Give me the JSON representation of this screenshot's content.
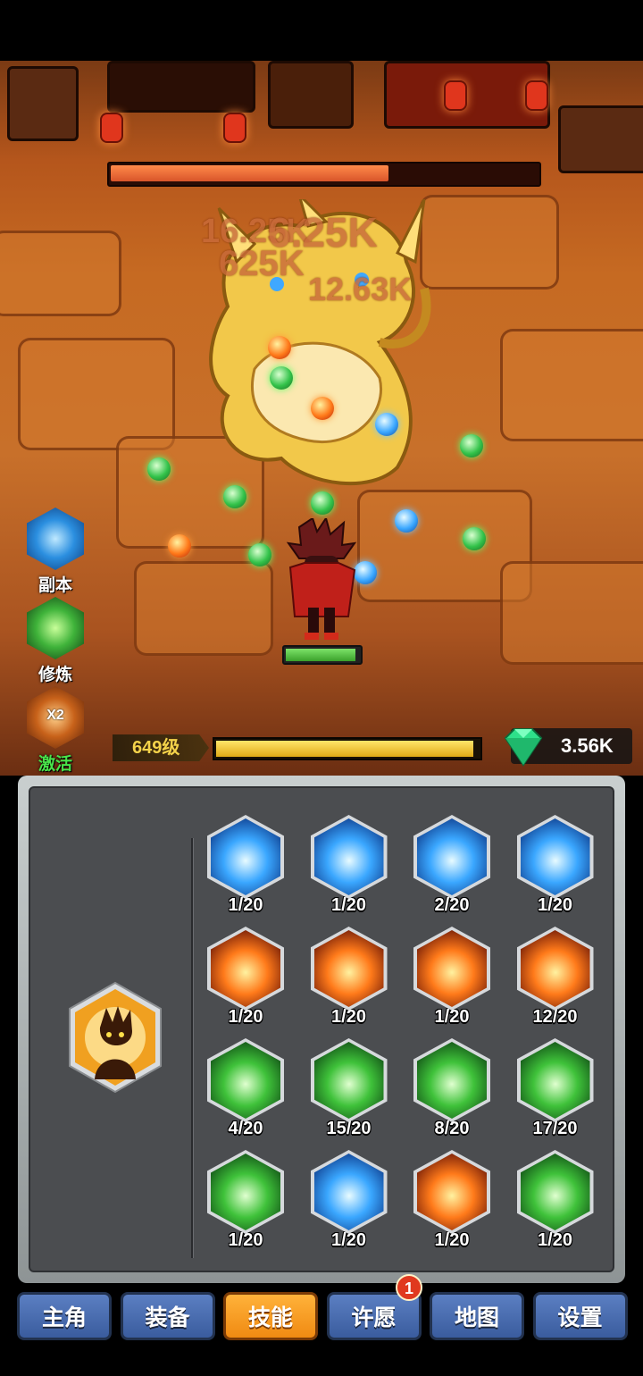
{
  "battle": {
    "damage_numbers": [
      "6.25K",
      "625K",
      "12.63K",
      "16.25K"
    ],
    "boss_hp_fraction": 0.65,
    "hero_hp_fraction": 0.95
  },
  "side_buttons": [
    {
      "label": "副本",
      "icon": "vortex-icon"
    },
    {
      "label": "修炼",
      "icon": "cultivation-icon"
    },
    {
      "label": "激活",
      "icon": "double-boost-icon",
      "icon_text": "X2",
      "highlight": "#49e34a"
    }
  ],
  "player": {
    "level_label": "649级",
    "xp_fraction": 0.98,
    "gems": "3.56K"
  },
  "skills": [
    {
      "level": "1/20",
      "element": "ice",
      "icon": "ice-burst-icon"
    },
    {
      "level": "1/20",
      "element": "ice",
      "icon": "tornado-icon"
    },
    {
      "level": "2/20",
      "element": "ice",
      "icon": "wave-icon"
    },
    {
      "level": "1/20",
      "element": "ice",
      "icon": "ice-spikes-icon"
    },
    {
      "level": "1/20",
      "element": "fire",
      "icon": "fire-wall-icon"
    },
    {
      "level": "1/20",
      "element": "fire",
      "icon": "fire-explosion-icon"
    },
    {
      "level": "1/20",
      "element": "fire",
      "icon": "fire-wave-icon"
    },
    {
      "level": "12/20",
      "element": "fire",
      "icon": "fire-ring-icon"
    },
    {
      "level": "4/20",
      "element": "wind",
      "icon": "leaf-cut-icon"
    },
    {
      "level": "15/20",
      "element": "wind",
      "icon": "lightning-icon"
    },
    {
      "level": "8/20",
      "element": "wind",
      "icon": "whirlwind-icon"
    },
    {
      "level": "17/20",
      "element": "wind",
      "icon": "spirit-icon"
    },
    {
      "level": "1/20",
      "element": "wind",
      "icon": "heal-heart-icon"
    },
    {
      "level": "1/20",
      "element": "ice",
      "icon": "spiral-icon"
    },
    {
      "level": "1/20",
      "element": "fire",
      "icon": "inferno-icon"
    },
    {
      "level": "1/20",
      "element": "wind",
      "icon": "thorns-icon"
    }
  ],
  "hero_skill": {
    "icon": "hero-portrait-icon"
  },
  "tabs": [
    {
      "label": "主角",
      "active": false
    },
    {
      "label": "装备",
      "active": false
    },
    {
      "label": "技能",
      "active": true
    },
    {
      "label": "许愿",
      "active": false,
      "badge": "1"
    },
    {
      "label": "地图",
      "active": false
    },
    {
      "label": "设置",
      "active": false
    }
  ],
  "colors": {
    "tab_default": "#4a6cb0",
    "tab_active": "#f5a020",
    "xp": "#f3c522",
    "gem": "#2ee08a",
    "boss_hp": "#e8673a",
    "hero_hp": "#5cc84a"
  }
}
